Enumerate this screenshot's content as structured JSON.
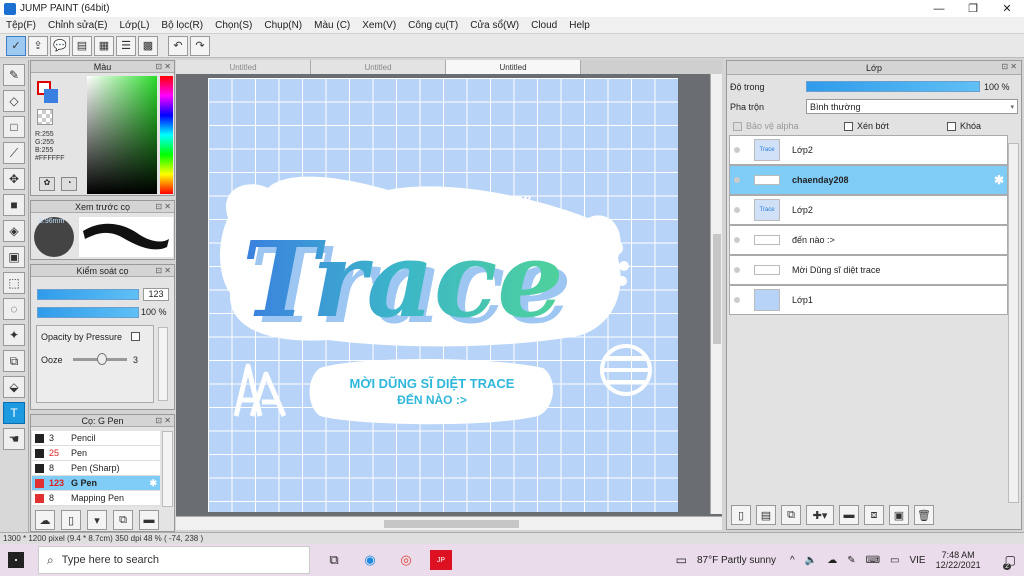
{
  "window": {
    "title": "JUMP PAINT (64bit)",
    "minimize": "—",
    "restore": "❐",
    "close": "✕"
  },
  "menu": [
    "Tệp(F)",
    "Chỉnh sửa(E)",
    "Lớp(L)",
    "Bộ lọc(R)",
    "Chọn(S)",
    "Chụp(N)",
    "Màu (C)",
    "Xem(V)",
    "Công cụ(T)",
    "Cửa sổ(W)",
    "Cloud",
    "Help"
  ],
  "color_panel": {
    "title": "Màu",
    "r": "R:255",
    "g": "G:255",
    "b": "B:255",
    "hex": "#FFFFFF",
    "primary_color": "#ffffff",
    "secondary_color": "#3a80e0"
  },
  "brush_preview": {
    "title": "Xem trước cọ",
    "size": "8.96mm"
  },
  "brush_control": {
    "title": "Kiểm soát cọ",
    "size_value": "123",
    "opacity_value": "100 %",
    "opacity_pressure_label": "Opacity by Pressure",
    "ooze_label": "Ooze",
    "ooze_value": "3"
  },
  "brush_list": {
    "title": "Cọ: G Pen",
    "items": [
      {
        "num": "3",
        "name": "Pencil",
        "color": "#222222",
        "num_color": "#222222"
      },
      {
        "num": "25",
        "name": "Pen",
        "color": "#222222",
        "num_color": "#e02020"
      },
      {
        "num": "8",
        "name": "Pen (Sharp)",
        "color": "#222222",
        "num_color": "#222222"
      },
      {
        "num": "123",
        "name": "G Pen",
        "color": "#e03030",
        "num_color": "#e02020"
      },
      {
        "num": "8",
        "name": "Mapping Pen",
        "color": "#e03030",
        "num_color": "#222222"
      }
    ]
  },
  "tabs": [
    "Untitled",
    "Untitled",
    "Untitled"
  ],
  "artwork": {
    "credit_line1": "CHAENDAY208",
    "credit_line2": "#HD247",
    "main_word": "Trace",
    "banner_line1": "MỜI DŨNG SĨ DIỆT TRACE",
    "banner_line2": "ĐẾN NÀO :>"
  },
  "layer_panel": {
    "title": "Lớp",
    "opacity_label": "Độ trong",
    "opacity_value": "100 %",
    "blend_label": "Pha trộn",
    "blend_value": "Bình thường",
    "protect_alpha": "Bảo vệ alpha",
    "clipping": "Xén bớt",
    "lock": "Khóa",
    "layers": [
      {
        "name": "Lớp2",
        "selected": false,
        "thumb": "Trace"
      },
      {
        "name": "chaenday208",
        "selected": true,
        "thumb": ""
      },
      {
        "name": "Lớp2",
        "selected": false,
        "thumb": "Trace"
      },
      {
        "name": "đến nào :>",
        "selected": false,
        "thumb": ""
      },
      {
        "name": "Mời Dũng sĩ diệt trace",
        "selected": false,
        "thumb": ""
      },
      {
        "name": "Lớp1",
        "selected": false,
        "thumb": ""
      }
    ]
  },
  "status": {
    "text": "1300 * 1200 pixel  (9.4 * 8.7cm)  350 dpi  48 %  ( -74, 238 )"
  },
  "taskbar": {
    "search_placeholder": "Type here to search",
    "weather": "87°F  Partly sunny",
    "lang": "VIE",
    "time": "7:48 AM",
    "date": "12/22/2021",
    "notif_count": "2"
  }
}
